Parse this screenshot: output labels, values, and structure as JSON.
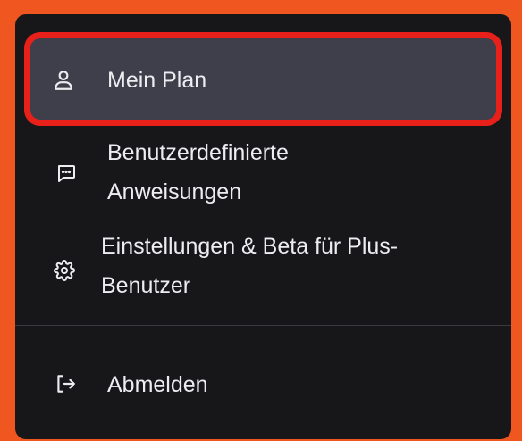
{
  "menu": {
    "items": [
      {
        "label": "Mein Plan",
        "icon": "user-icon",
        "highlighted": true
      },
      {
        "label_line1": "Benutzerdefinierte",
        "label_line2": "Anweisungen",
        "icon": "message-square-icon"
      },
      {
        "label_line1": "Einstellungen & Beta für Plus-",
        "label_line2": "Benutzer",
        "icon": "gear-icon"
      },
      {
        "label": "Abmelden",
        "icon": "logout-icon"
      }
    ]
  },
  "colors": {
    "background": "#f0561f",
    "panel": "#17171a",
    "highlight_fill": "#3e3f4b",
    "highlight_border": "#e8201a",
    "text": "#ececf1"
  }
}
